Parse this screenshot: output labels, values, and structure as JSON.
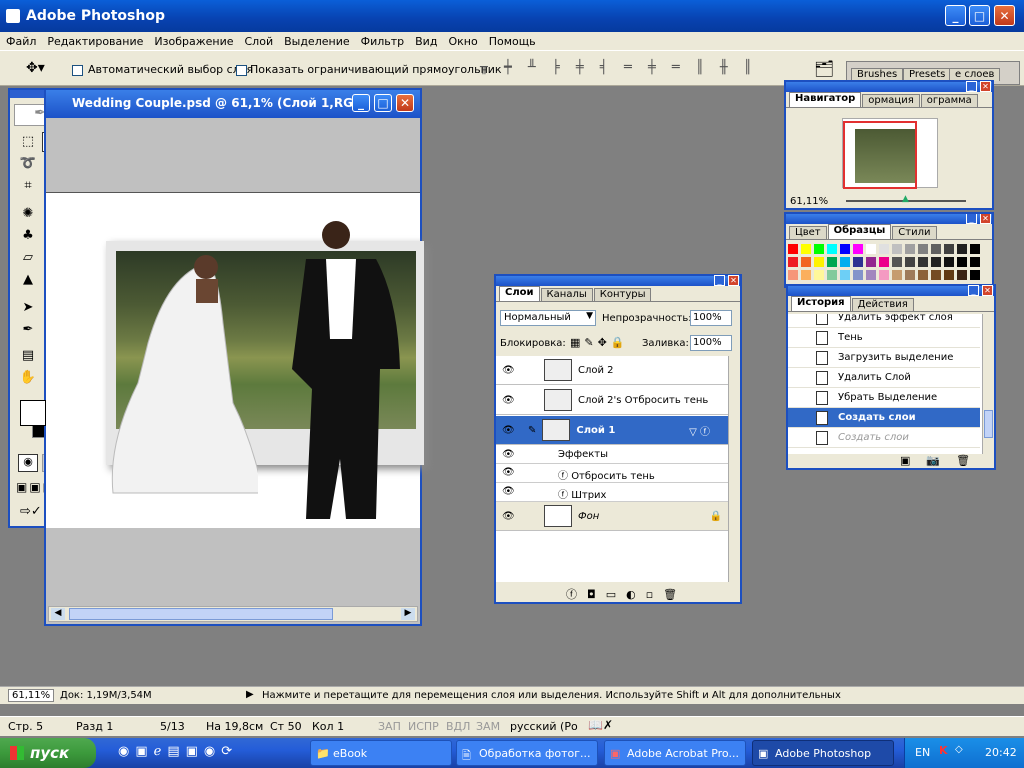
{
  "app": {
    "title": "Adobe Photoshop"
  },
  "menu": [
    "Файл",
    "Редактирование",
    "Изображение",
    "Слой",
    "Выделение",
    "Фильтр",
    "Вид",
    "Окно",
    "Помощь"
  ],
  "options": {
    "auto_select": "Автоматический выбор слоя",
    "show_bounds": "Показать ограничивающий прямоугольник"
  },
  "palette_well": {
    "tabs": [
      "Brushes",
      "Presets",
      "е слоев"
    ]
  },
  "document": {
    "title": "Wedding Couple.psd @ 61,1% (Слой 1,RG..."
  },
  "navigator": {
    "tabs": [
      "Навигатор",
      "ормация",
      "ограмма"
    ],
    "zoom": "61,11%"
  },
  "swatches": {
    "tabs": [
      "Цвет",
      "Образцы",
      "Стили"
    ]
  },
  "history": {
    "tabs": [
      "История",
      "Действия"
    ],
    "items": [
      "Удалить эффект слоя",
      "Тень",
      "Загрузить выделение",
      "Удалить Слой",
      "Убрать Выделение",
      "Создать слои",
      "Создать слои"
    ],
    "active_index": 5
  },
  "layers": {
    "tabs": [
      "Слои",
      "Каналы",
      "Контуры"
    ],
    "blend_mode": "Нормальный",
    "opacity_label": "Непрозрачность:",
    "opacity": "100%",
    "lock_label": "Блокировка:",
    "fill_label": "Заливка:",
    "fill": "100%",
    "rows": [
      "Слой 2",
      "Слой 2's Отбросить тень",
      "Слой 1"
    ],
    "effects_label": "Эффекты",
    "effects": [
      "Отбросить тень",
      "Штрих"
    ],
    "background": "Фон"
  },
  "status": {
    "zoom": "61,11%",
    "doc": "Док: 1,19M/3,54M",
    "hint": "Нажмите и перетащите для перемещения слоя или выделения. Используйте Shift и Alt для дополнительных"
  },
  "word_status": {
    "page": "Стр. 5",
    "section": "Разд 1",
    "pages": "5/13",
    "at": "На 19,8см",
    "line": "Ст 50",
    "col": "Кол 1",
    "flags": [
      "ЗАП",
      "ИСПР",
      "ВДЛ",
      "ЗАМ"
    ],
    "lang": "русский (Ро"
  },
  "taskbar": {
    "start": "пуск",
    "items": [
      "eBook",
      "Обработка фотог...",
      "Adobe Acrobat Pro...",
      "Adobe Photoshop"
    ],
    "lang": "EN",
    "clock": "20:42"
  },
  "colors": {
    "xp_blue": "#0842b0",
    "start_green": "#3c9a3c",
    "highlight": "#3169c6"
  }
}
